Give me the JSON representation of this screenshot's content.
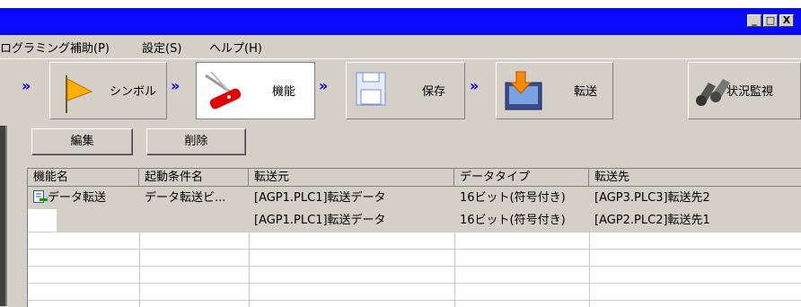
{
  "window": {
    "title_buttons": [
      "_",
      "□",
      "X"
    ]
  },
  "menu": {
    "items": [
      "ログラミング補助(P)",
      "設定(S)",
      "ヘルプ(H)"
    ]
  },
  "steps": [
    {
      "label": "シンボル",
      "icon": "flag-icon"
    },
    {
      "label": "機能",
      "icon": "swiss-knife-icon",
      "active": true
    },
    {
      "label": "保存",
      "icon": "floppy-disk-icon"
    },
    {
      "label": "転送",
      "icon": "transfer-icon"
    },
    {
      "label": "状況監視",
      "icon": "binoculars-icon"
    }
  ],
  "buttons": {
    "edit": "編集",
    "delete": "削除"
  },
  "table": {
    "columns": [
      "機能名",
      "起動条件名",
      "転送元",
      "データタイプ",
      "転送先"
    ],
    "rows": [
      {
        "func": "データ転送",
        "cond": "データ転送ビ...",
        "src": "[AGP1.PLC1]転送データ",
        "type": "16ビット(符号付き)",
        "dst": "[AGP3.PLC3]転送先2"
      },
      {
        "func": "",
        "cond": "",
        "src": "[AGP1.PLC1]転送データ",
        "type": "16ビット(符号付き)",
        "dst": "[AGP2.PLC2]転送先1"
      }
    ]
  },
  "colors": {
    "title_bar": "#0a0aff",
    "face": "#d4d0c8",
    "arrow": "#0000ff"
  }
}
